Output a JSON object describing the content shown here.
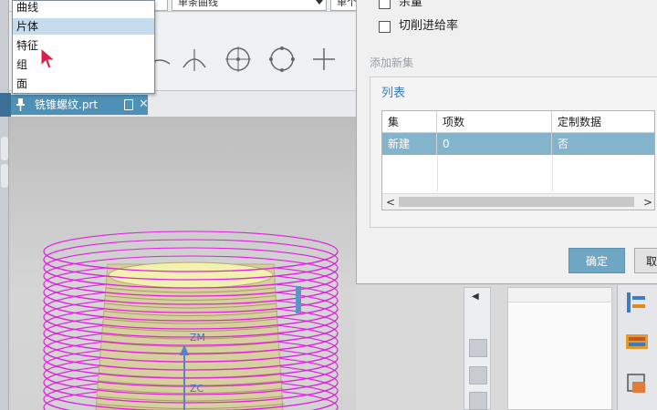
{
  "menu": {
    "items": [
      {
        "label": "曲线",
        "highlighted": false
      },
      {
        "label": "片体",
        "highlighted": true
      },
      {
        "label": "特征",
        "highlighted": false
      },
      {
        "label": "组",
        "highlighted": false
      },
      {
        "label": "面",
        "highlighted": false
      }
    ]
  },
  "toolbar": {
    "curve_filter_value": "单条曲线",
    "third_combo_value": "单个",
    "snap_icons": [
      "endpoint-snap-icon",
      "arc-center-snap-icon",
      "circle-center-snap-icon",
      "quadrant-snap-icon",
      "crosshair-snap-icon"
    ]
  },
  "file_tab": {
    "title": "铣锥螺纹.prt",
    "close_label": "✕"
  },
  "viewport": {
    "axis_z_label": "ZM",
    "axis_zc_label": "ZC",
    "colors": {
      "helix": "#e020e0",
      "cone_top": "#f3f1b0",
      "cone_body": "#d8cfa0",
      "background": "#c9c9c9"
    }
  },
  "dialog": {
    "checkbox_partial_label": "余量",
    "checkbox_feed_label": "切削进给率",
    "add_new_set_label": "添加新集",
    "list_group_label": "列表",
    "table": {
      "columns": [
        "集",
        "项数",
        "定制数据"
      ],
      "rows": [
        {
          "set": "新建",
          "count": "0",
          "custom": "否",
          "selected": true
        }
      ]
    },
    "scroll_left": "<",
    "scroll_right": ">",
    "ok_label": "确定",
    "cancel_label": "取"
  },
  "colors": {
    "accent": "#4f91b6",
    "selection": "#84b4cc",
    "ok_button": "#6ea6c4"
  }
}
